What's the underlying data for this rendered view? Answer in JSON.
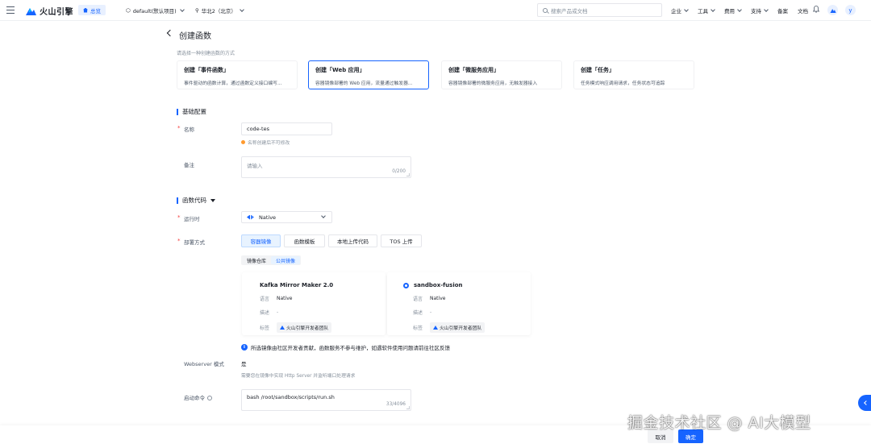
{
  "header": {
    "logo_text": "火山引擎",
    "home_label": "总览",
    "project": "default(默认项目)",
    "region": "华北2（北京）",
    "search_placeholder": "搜索产品或文档",
    "nav": [
      "企业",
      "工具",
      "费用",
      "支持",
      "备案",
      "文档"
    ],
    "avatar_letter": "y"
  },
  "page": {
    "title": "创建函数",
    "hint": "请选择一种创建函数的方式"
  },
  "cards": [
    {
      "title": "创建「事件函数」",
      "desc": "事件驱动的函数计算，通过函数定义接口编写..."
    },
    {
      "title": "创建「Web 应用」",
      "desc": "容器镜像部署的 Web 应用，流量通过触发器..."
    },
    {
      "title": "创建「微服务应用」",
      "desc": "容器镜像部署的微服务应用，无触发器接入"
    },
    {
      "title": "创建「任务」",
      "desc": "任务模式响应调用请求，任务状态可追踪"
    }
  ],
  "basic": {
    "section_title": "基础配置",
    "name_label": "名称",
    "name_value": "code-tes",
    "name_warning": "名称创建后不可修改",
    "remark_label": "备注",
    "remark_placeholder": "请输入",
    "remark_counter": "0/200"
  },
  "code": {
    "section_title": "函数代码",
    "runtime_label": "运行时",
    "runtime_value": "Native",
    "deploy_label": "部署方式",
    "deploy_options": [
      "容器镜像",
      "函数模板",
      "本地上传代码",
      "TOS 上传"
    ],
    "repo_tabs": [
      "镜像仓库",
      "公共镜像"
    ]
  },
  "images": [
    {
      "name": "Kafka Mirror Maker 2.0",
      "lang_label": "语言",
      "lang": "Native",
      "desc_label": "描述",
      "desc": "-",
      "tag_label": "标签",
      "tag": "火山引擎开发者团队"
    },
    {
      "name": "sandbox-fusion",
      "lang_label": "语言",
      "lang": "Native",
      "desc_label": "描述",
      "desc": "-",
      "tag_label": "标签",
      "tag": "火山引擎开发者团队"
    }
  ],
  "info_text": "所选镜像由社区开发者贡献，函数服务不参与维护，如遇软件使用问题请前往社区反馈",
  "webserver": {
    "label": "Webserver 模式",
    "value": "是",
    "hint": "需要您在镜像中实现 Http Server 并监听端口处理请求"
  },
  "startup": {
    "label": "启动命令",
    "value": "bash /root/sandbox/scripts/run.sh",
    "counter": "33/4096"
  },
  "footer": {
    "cancel": "取消",
    "ok": "确定"
  },
  "watermark": "掘金技术社区 @ AI大模型",
  "colors": {
    "accent": "#1664ff",
    "required": "#f53f3f",
    "warning": "#ff9a2e"
  }
}
